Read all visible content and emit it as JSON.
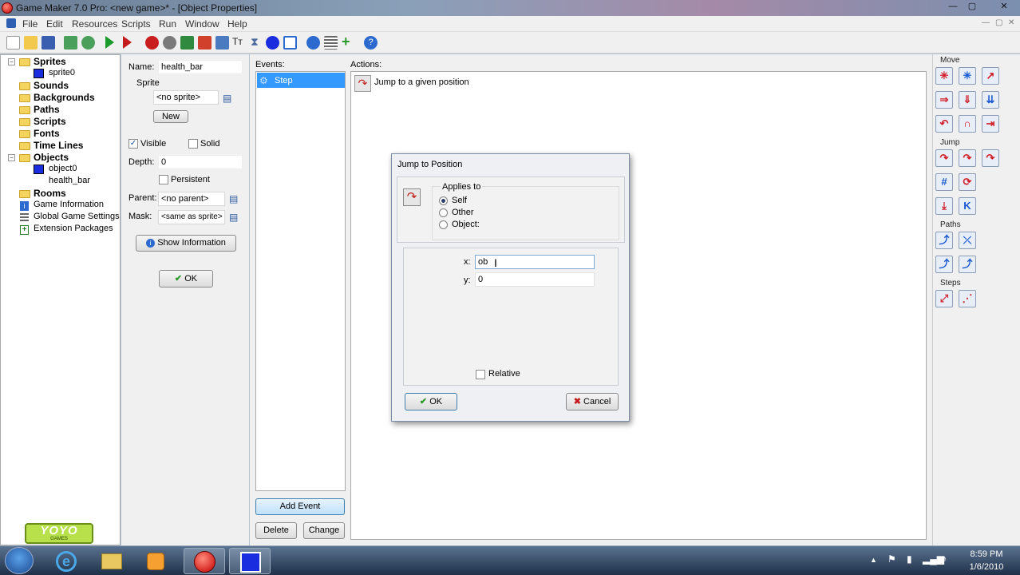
{
  "window": {
    "title": "Game Maker 7.0 Pro: <new game>* - [Object Properties]",
    "min": "—",
    "max": "▢",
    "close": "✕"
  },
  "menu": [
    "File",
    "Edit",
    "Resources",
    "Scripts",
    "Run",
    "Window",
    "Help"
  ],
  "tree": {
    "sprites": "Sprites",
    "sprite0": "sprite0",
    "sounds": "Sounds",
    "backgrounds": "Backgrounds",
    "paths": "Paths",
    "scripts": "Scripts",
    "fonts": "Fonts",
    "timelines": "Time Lines",
    "objects": "Objects",
    "object0": "object0",
    "health_bar": "health_bar",
    "rooms": "Rooms",
    "gameinfo": "Game Information",
    "globalsettings": "Global Game Settings",
    "extensions": "Extension Packages",
    "logo": "YOYO",
    "logo_sub": "GAMES"
  },
  "props": {
    "name_label": "Name:",
    "name_value": "health_bar",
    "sprite_label": "Sprite",
    "sprite_value": "<no sprite>",
    "new_button": "New",
    "visible_label": "Visible",
    "solid_label": "Solid",
    "depth_label": "Depth:",
    "depth_value": "0",
    "persistent_label": "Persistent",
    "parent_label": "Parent:",
    "parent_value": "<no parent>",
    "mask_label": "Mask:",
    "mask_value": "<same as sprite>",
    "show_info_button": "Show Information",
    "ok_button": "OK"
  },
  "events": {
    "label": "Events:",
    "items": [
      "Step"
    ],
    "add_button": "Add Event",
    "delete_button": "Delete",
    "change_button": "Change"
  },
  "actions": {
    "label": "Actions:",
    "items": [
      "Jump to a given position"
    ]
  },
  "library": {
    "move": "Move",
    "jump": "Jump",
    "paths": "Paths",
    "steps": "Steps"
  },
  "dialog": {
    "title": "Jump to Position",
    "applies_to": "Applies to",
    "opt_self": "Self",
    "opt_other": "Other",
    "opt_object": "Object:",
    "x_label": "x:",
    "x_value": "ob",
    "y_label": "y:",
    "y_value": "0",
    "relative_label": "Relative",
    "ok_button": "OK",
    "cancel_button": "Cancel"
  },
  "taskbar": {
    "time": "8:59 PM",
    "date": "1/6/2010"
  },
  "colors": {
    "selection": "#3399ff",
    "accent": "#1a2ee0"
  }
}
